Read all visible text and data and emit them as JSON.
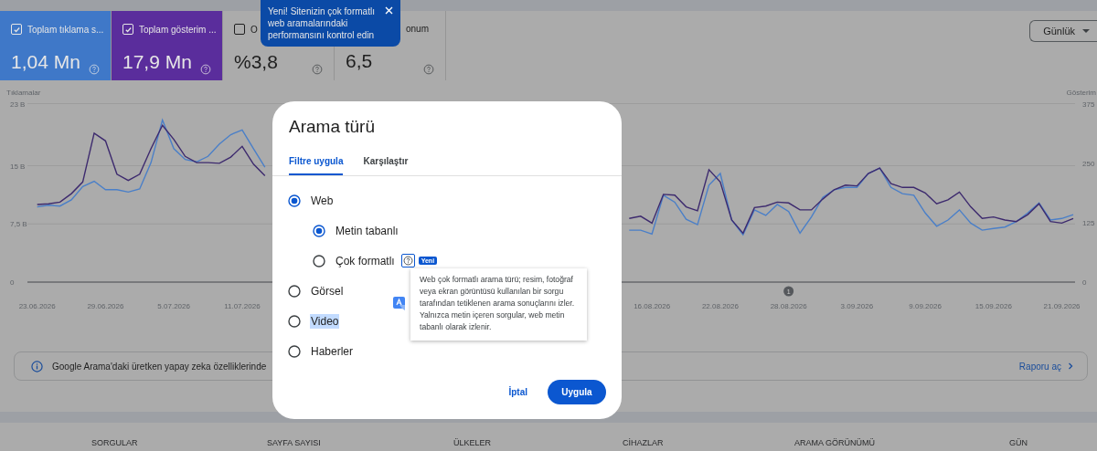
{
  "metric_cards": [
    {
      "label": "Toplam tıklama s...",
      "value": "1,04 Mn",
      "checked": true
    },
    {
      "label": "Toplam gösterim ...",
      "value": "17,9 Mn",
      "checked": true
    },
    {
      "label": "O",
      "value": "%3,8",
      "checked": false
    },
    {
      "label": "onum",
      "value": "6,5"
    }
  ],
  "period_dropdown": {
    "value": "Günlük"
  },
  "announcement_tooltip": {
    "text": "Yeni! Sitenizin çok formatlı web aramalarındaki performansını kontrol edin"
  },
  "chart": {
    "right_axis": {
      "label": "Gösterim",
      "ticks": [
        "375",
        "250",
        "125",
        "0"
      ]
    },
    "chart_data": {
      "type": "line",
      "ylabel": "Tıklamalar",
      "ylim": [
        0,
        23
      ],
      "categories": [
        "23.06.2026",
        null,
        null,
        null,
        null,
        null,
        "29.06.2026",
        null,
        null,
        null,
        null,
        null,
        "5.07.2026",
        null,
        null,
        null,
        null,
        null,
        "11.07.2026",
        null,
        null,
        null,
        null,
        null,
        null,
        null,
        null,
        null,
        null,
        null,
        null,
        null,
        null,
        null,
        null,
        null,
        null,
        null,
        null,
        null,
        null,
        null,
        null,
        null,
        null,
        null,
        null,
        null,
        null,
        null,
        null,
        null,
        null,
        null,
        "16.08.2026",
        null,
        null,
        null,
        null,
        null,
        "22.08.2026",
        null,
        null,
        null,
        null,
        null,
        "28.08.2026",
        null,
        null,
        null,
        null,
        null,
        "3.09.2026",
        null,
        null,
        null,
        null,
        null,
        "9.09.2026",
        null,
        null,
        null,
        null,
        null,
        "15.09.2026",
        null,
        null,
        null,
        null,
        null,
        "21.09.2026",
        null
      ],
      "series": [
        {
          "color": "#4a7fc8",
          "values": [
            9.7,
            9.9,
            9.8,
            10.6,
            12.3,
            13.0,
            11.9,
            11.9,
            11.6,
            12.0,
            15.4,
            20.9,
            17.2,
            15.8,
            15.5,
            16.2,
            17.8,
            19.0,
            19.6,
            17.2,
            14.8,
            null,
            null,
            null,
            null,
            null,
            null,
            null,
            null,
            null,
            null,
            null,
            null,
            null,
            null,
            null,
            null,
            null,
            null,
            null,
            null,
            null,
            null,
            null,
            null,
            null,
            null,
            null,
            null,
            null,
            null,
            null,
            6.7,
            6.7,
            6.2,
            11.2,
            10.3,
            8.1,
            7.4,
            12.5,
            14.0,
            8.0,
            6.1,
            9.3,
            8.6,
            10.0,
            9.1,
            6.3,
            8.4,
            10.9,
            11.9,
            12.2,
            12.2,
            14.0,
            14.7,
            12.2,
            11.4,
            11.2,
            8.9,
            7.2,
            8.0,
            9.3,
            7.6,
            6.7,
            6.9,
            7.1,
            7.8,
            8.9,
            10.2,
            8.0,
            8.2,
            8.7
          ]
        },
        {
          "color": "#3d2a6e",
          "values": [
            10.0,
            10.1,
            10.3,
            11.4,
            12.9,
            19.2,
            18.2,
            13.9,
            13.1,
            13.9,
            17.2,
            20.2,
            18.4,
            16.2,
            15.4,
            15.4,
            15.3,
            16.1,
            17.5,
            15.2,
            13.7,
            null,
            null,
            null,
            null,
            null,
            null,
            null,
            null,
            null,
            null,
            null,
            null,
            null,
            null,
            null,
            null,
            null,
            null,
            null,
            null,
            null,
            null,
            null,
            null,
            null,
            null,
            null,
            null,
            null,
            null,
            null,
            8.2,
            8.5,
            7.6,
            11.3,
            11.2,
            9.7,
            9.2,
            14.5,
            12.9,
            8.0,
            6.3,
            9.6,
            9.8,
            10.3,
            10.2,
            9.3,
            9.3,
            10.7,
            11.9,
            12.5,
            12.4,
            14.0,
            14.7,
            12.7,
            12.2,
            12.2,
            11.5,
            10.1,
            10.6,
            11.6,
            9.7,
            8.2,
            8.4,
            8.0,
            7.8,
            8.7,
            10.1,
            7.8,
            7.6,
            8.2
          ]
        }
      ],
      "yticks": [
        0,
        {
          "value": 7.5,
          "label": "7,5 B"
        },
        {
          "value": 15,
          "label": "15 B"
        },
        {
          "value": 23,
          "label": "23 B"
        }
      ],
      "annotations": [
        "1"
      ]
    }
  },
  "info_banner": {
    "text": "Google Arama'daki üretken yapay zeka özelliklerinde",
    "link": "Raporu aç"
  },
  "report_tabs": [
    "SORGULAR",
    "SAYFA SAYISI",
    "ÜLKELER",
    "CİHAZLAR",
    "ARAMA GÖRÜNÜMÜ",
    "GÜN"
  ],
  "dialog": {
    "title": "Arama türü",
    "tabs": [
      {
        "label": "Filtre uygula",
        "selected": true
      },
      {
        "label": "Karşılaştır",
        "selected": false
      }
    ],
    "options": [
      {
        "label": "Web",
        "selected": true,
        "highlighted": false,
        "children": [
          {
            "label": "Metin tabanlı",
            "selected": true,
            "highlighted": false
          },
          {
            "label": "Çok formatlı",
            "selected": false,
            "highlighted": false,
            "badge": "Yeni"
          }
        ]
      },
      {
        "label": "Görsel",
        "selected": false,
        "highlighted": false
      },
      {
        "label": "Video",
        "selected": false,
        "highlighted": true
      },
      {
        "label": "Haberler",
        "selected": false,
        "highlighted": false
      }
    ],
    "help_popup": "Web çok formatlı arama türü; resim, fotoğraf veya ekran görüntüsü kullanılan bir sorgu tarafından tetiklenen arama sonuçlarını izler. Yalnızca metin içeren sorgular, web metin tabanlı olarak izlenir.",
    "cancel_button": "İptal",
    "apply_button": "Uygula"
  }
}
